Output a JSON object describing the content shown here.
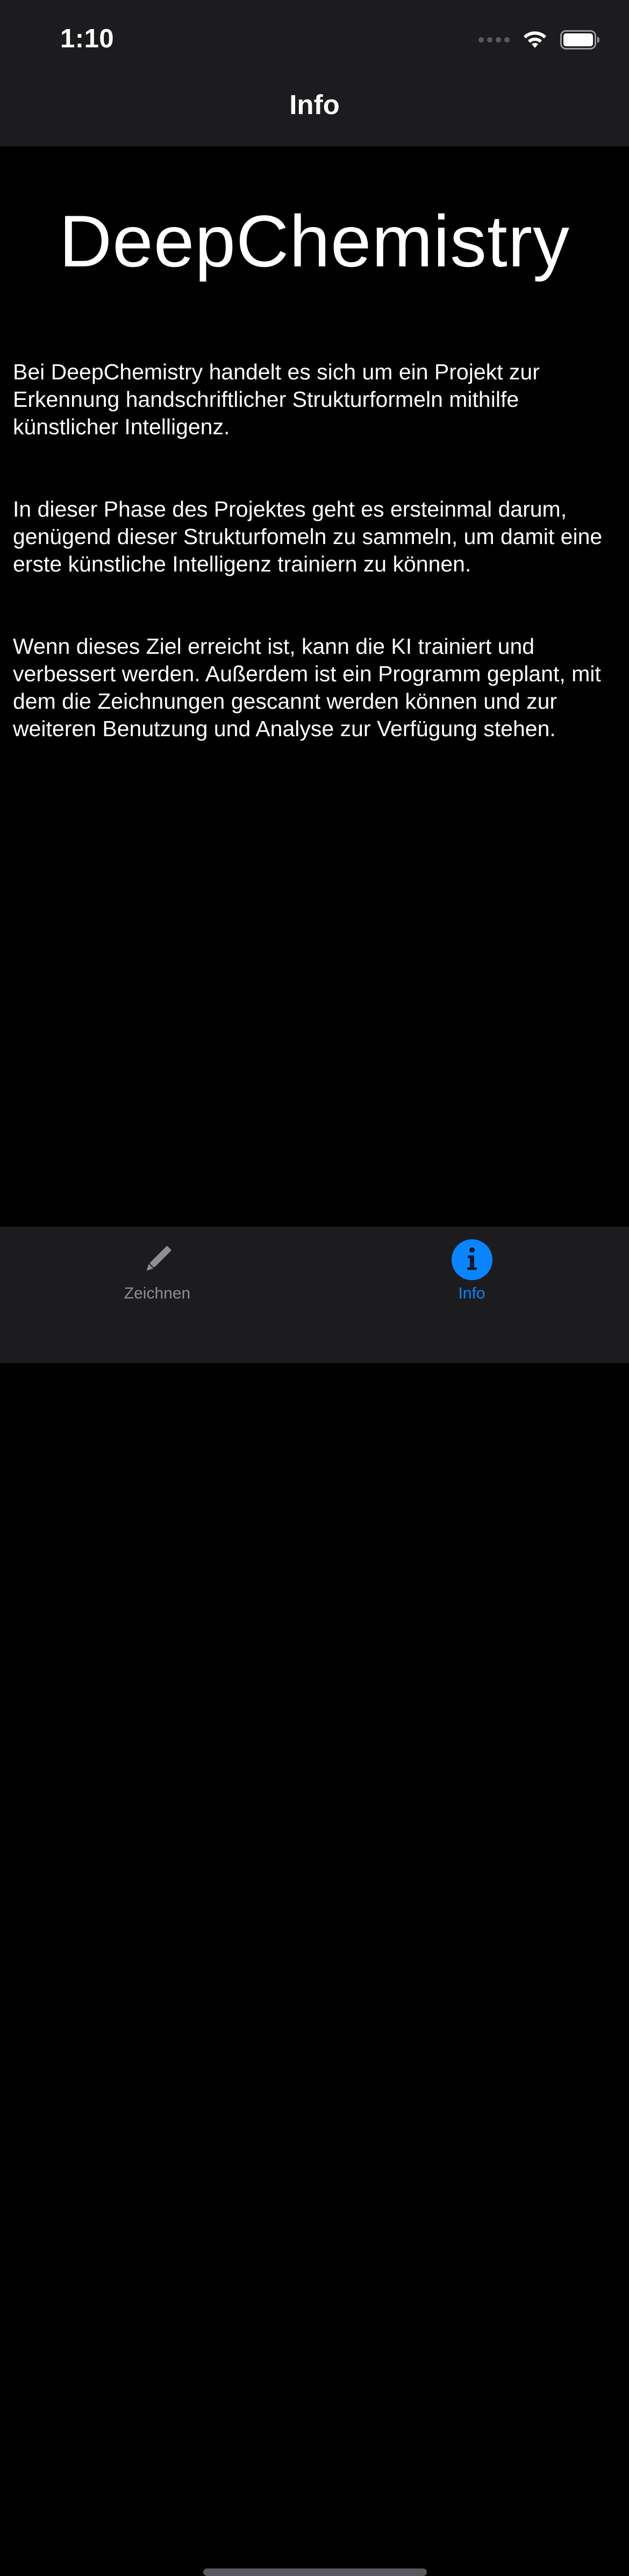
{
  "status_bar": {
    "time": "1:10",
    "icons": [
      "signal-dots-icon",
      "wifi-icon",
      "battery-icon"
    ]
  },
  "nav": {
    "title": "Info"
  },
  "content": {
    "app_title": "DeepChemistry",
    "paragraphs": [
      "Bei DeepChemistry handelt es sich um ein Projekt zur Erkennung handschriftlicher Strukturformeln mithilfe künstlicher Intelligenz.",
      "In dieser Phase des Projektes geht es ersteinmal darum, genügend dieser Strukturfomeln zu sammeln, um damit eine erste künstliche Intelligenz trainiern zu können.",
      "Wenn dieses Ziel erreicht ist, kann die KI trainiert und verbessert werden. Außerdem ist ein Programm geplant, mit dem die Zeichnungen gescannt werden können und zur weiteren Benutzung und Analyse zur Verfügung stehen."
    ]
  },
  "tab_bar": {
    "tabs": [
      {
        "label": "Zeichnen",
        "icon": "pencil-icon",
        "selected": false
      },
      {
        "label": "Info",
        "icon": "info-icon",
        "selected": true
      }
    ]
  },
  "colors": {
    "background": "#000000",
    "bars": "#1c1c1e",
    "accent": "#0a84ff",
    "inactive": "#8e8e93"
  }
}
